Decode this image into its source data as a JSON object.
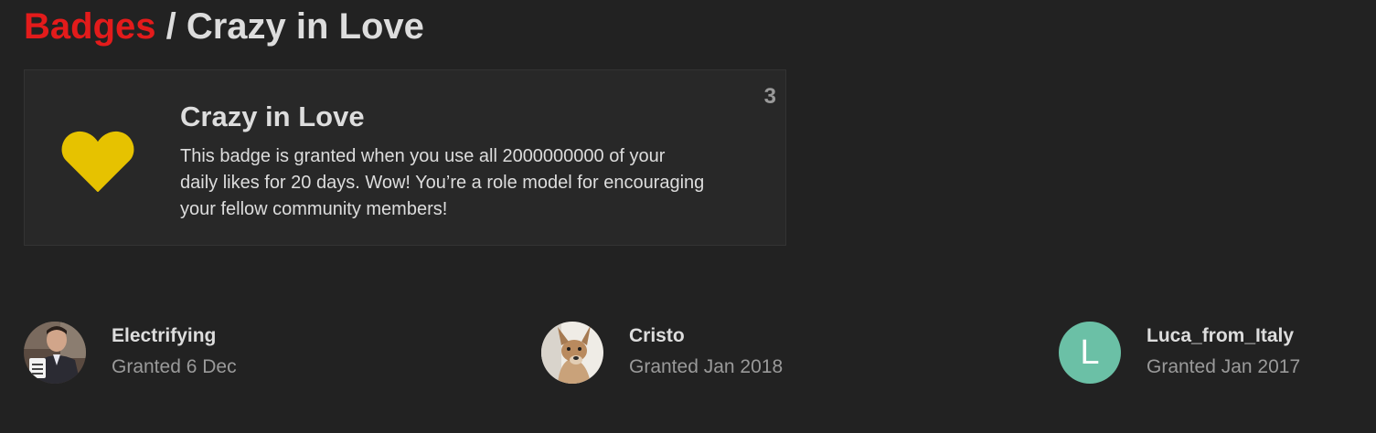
{
  "breadcrumb": {
    "parent_label": "Badges",
    "separator": " / ",
    "current_label": "Crazy in Love"
  },
  "badge": {
    "name": "Crazy in Love",
    "description": "This badge is granted when you use all 2000000000 of your daily likes for 20 days. Wow! You’re a role model for encouraging your fellow community members!",
    "grant_count": "3",
    "icon": "heart-icon",
    "icon_color": "#e6c200"
  },
  "grantees": [
    {
      "username": "Electrifying",
      "granted": "Granted 6 Dec",
      "avatar": "photo-avatar"
    },
    {
      "username": "Cristo",
      "granted": "Granted Jan 2018",
      "avatar": "photo-avatar"
    },
    {
      "username": "Luca_from_Italy",
      "granted": "Granted Jan 2017",
      "avatar_letter": "L",
      "avatar_color": "#6bc0a6"
    }
  ],
  "colors": {
    "background": "#222222",
    "accent": "#e31b1b"
  }
}
